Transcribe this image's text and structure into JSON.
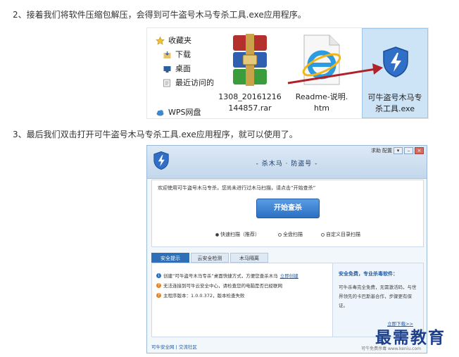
{
  "steps": {
    "step2": "2、接着我们将软件压缩包解压，会得到可牛盗号木马专杀工具.exe应用程序。",
    "step3": "3、最后我们双击打开可牛盗号木马专杀工具.exe应用程序，就可以使用了。"
  },
  "explorer": {
    "nav": [
      {
        "label": "收藏夹",
        "icon": "star-icon"
      },
      {
        "label": "下载",
        "icon": "download-folder-icon"
      },
      {
        "label": "桌面",
        "icon": "desktop-icon"
      },
      {
        "label": "最近访问的",
        "icon": "recent-places-icon"
      },
      {
        "label": "WPS网盘",
        "icon": "cloud-drive-icon"
      }
    ],
    "files": [
      {
        "name_line1": "1308_20161216",
        "name_line2": "144857.rar",
        "icon": "winrar-archive-icon"
      },
      {
        "name_line1": "Readme-说明.",
        "name_line2": "htm",
        "icon": "ie-html-icon"
      },
      {
        "name_line1": "可牛盗号木马专",
        "name_line2": "杀工具.exe",
        "icon": "shield-app-icon"
      }
    ]
  },
  "app": {
    "caption": "- 杀木马 · 防盗号 -",
    "menu_help": "求助",
    "menu_settings": "配置",
    "welcome": "欢迎使用可牛盗号木马专杀，您尚未进行过木马扫描，请点击“开始查杀”",
    "start_button": "开始查杀",
    "scan_options": [
      {
        "label": "快速扫描（推荐）",
        "checked": true
      },
      {
        "label": "全盘扫描",
        "checked": false
      },
      {
        "label": "自定义目录扫描",
        "checked": false
      }
    ],
    "tabs": [
      "安全提示",
      "云安全检测",
      "木马隔离"
    ],
    "messages": [
      {
        "text": "创建“可牛盗号木马专杀”桌面快捷方式，方便您查杀木马",
        "link": "立即创建",
        "color": "#2f6fb8",
        "symbol": "i"
      },
      {
        "text": "无法连接到可牛云安全中心，请检查您的电脑是否已经联网",
        "link": "",
        "color": "#e0862a",
        "symbol": "?"
      },
      {
        "text": "主程序版本：1.0.0.372，版本检查失败",
        "link": "",
        "color": "#e0862a",
        "symbol": "?"
      }
    ],
    "side": {
      "title": "安全免费，专业杀毒软件：",
      "text": "可牛杀毒完全免费，无需激活码，与世界领先的卡巴斯基合作，步骤更有保证。",
      "link": "立即下载>>"
    },
    "footer_links": "可牛安全网  |  交流社区",
    "footer_right": "可牛免费杀毒 www.keniu.com"
  },
  "watermark": "最需教育"
}
